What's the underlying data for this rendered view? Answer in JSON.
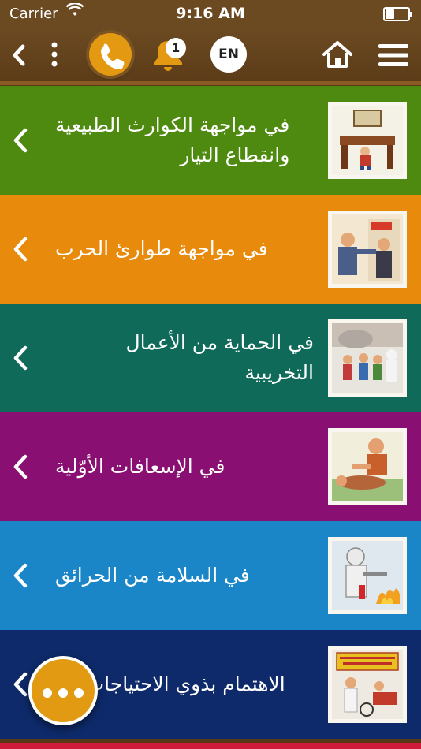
{
  "status_bar": {
    "carrier": "Carrier",
    "time": "9:16 AM"
  },
  "toolbar": {
    "notification_count": "1",
    "language_label": "EN"
  },
  "colors": {
    "toolbar": "#6b4a22",
    "accent": "#e39a12"
  },
  "items": [
    {
      "label": "في مواجهة الكوارث الطبيعية\nوانقطاع التيار",
      "color": "#4e8a10",
      "icon": "earthquake-illustration-icon"
    },
    {
      "label": "في مواجهة طوارئ الحرب",
      "color": "#e88a0c",
      "icon": "shelter-illustration-icon"
    },
    {
      "label": "في الحماية من الأعمال التخريبية",
      "color": "#0f6a5a",
      "icon": "evacuation-illustration-icon"
    },
    {
      "label": "في الإسعافات الأوّلية",
      "color": "#8a0f73",
      "icon": "first-aid-illustration-icon"
    },
    {
      "label": "في السلامة من الحرائق",
      "color": "#1a86c8",
      "icon": "firefighter-illustration-icon"
    },
    {
      "label": "الاهتمام بذوي الاحتياجات الخ",
      "color": "#0e2a6a",
      "icon": "special-needs-illustration-icon"
    }
  ]
}
